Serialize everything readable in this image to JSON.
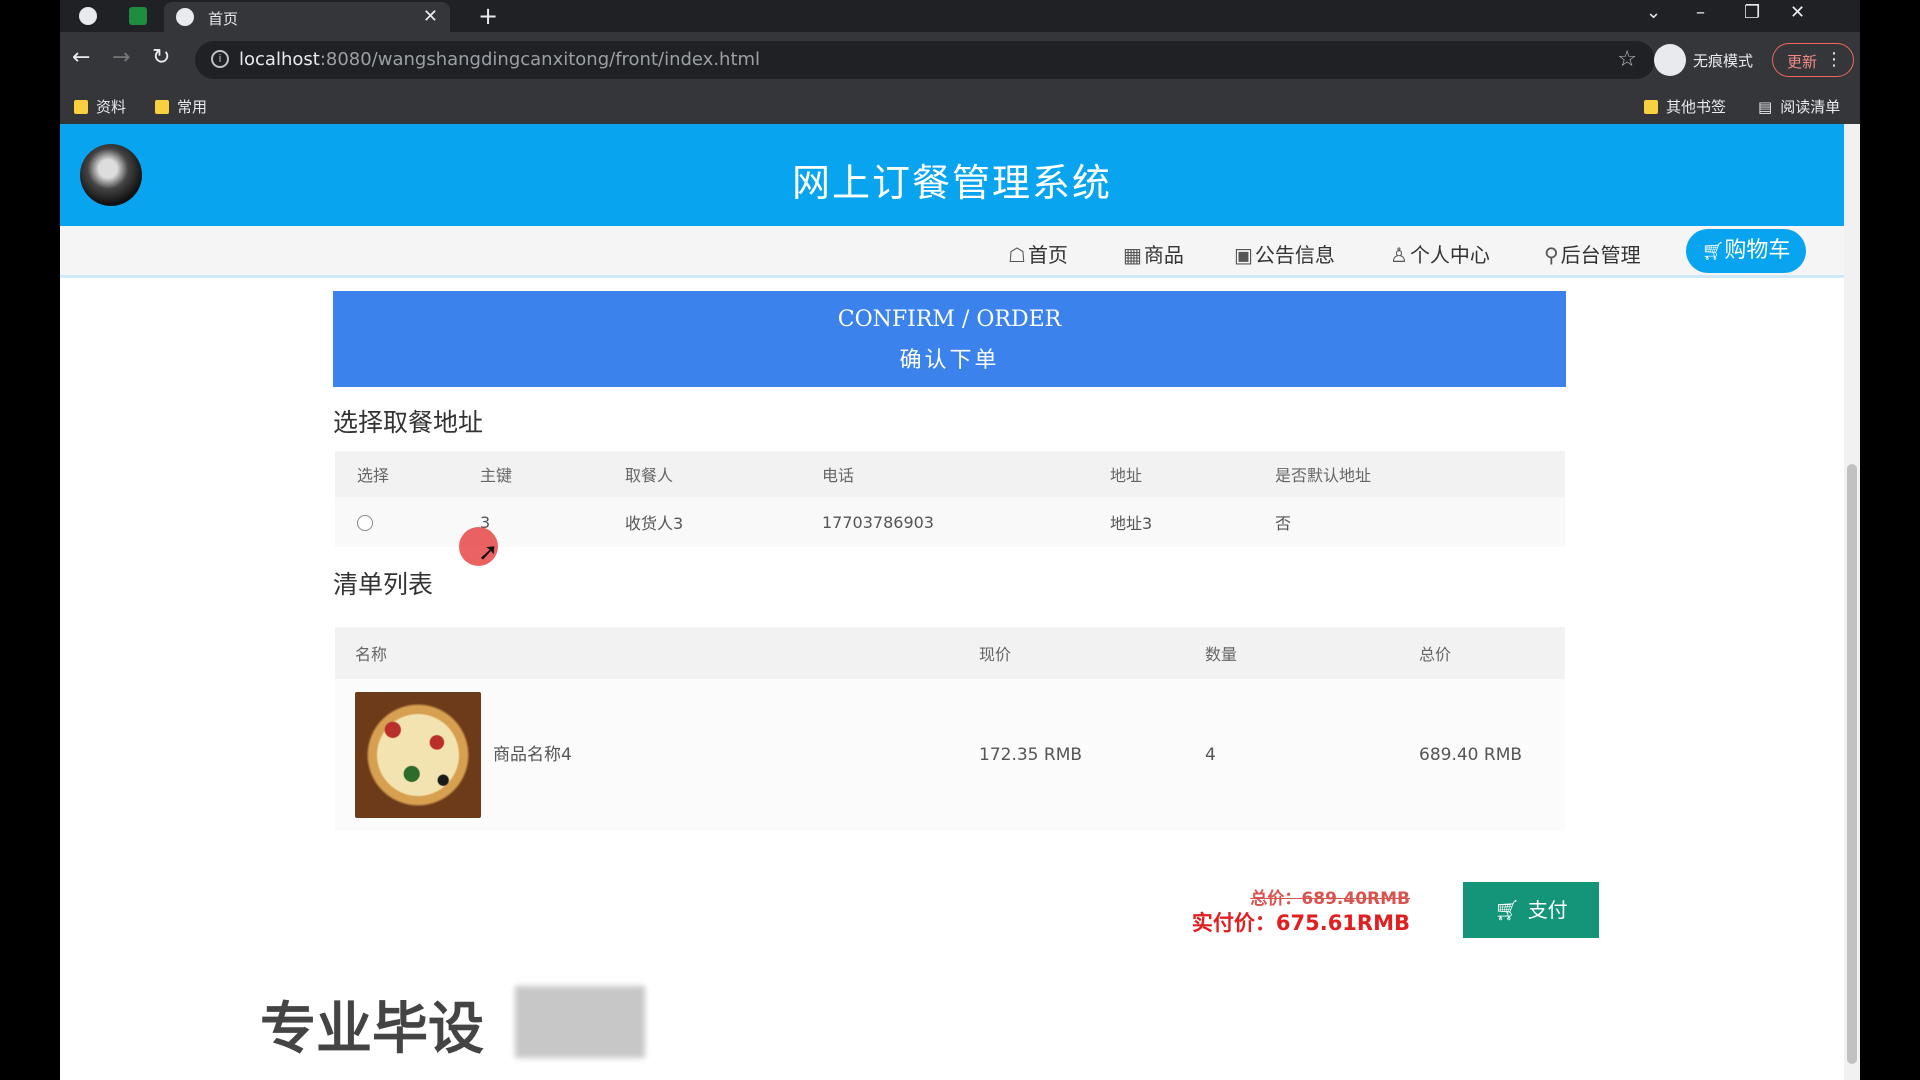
{
  "browser": {
    "tab_title": "首页",
    "url_host": "localhost",
    "url_rest": ":8080/wangshangdingcanxitong/front/index.html",
    "incognito_label": "无痕模式",
    "update_label": "更新",
    "bookmarks_left": [
      "资料",
      "常用"
    ],
    "bookmarks_right": [
      "其他书签",
      "阅读清单"
    ]
  },
  "site": {
    "title": "网上订餐管理系统",
    "nav": [
      {
        "icon": "☖",
        "label": "首页"
      },
      {
        "icon": "▦",
        "label": "商品"
      },
      {
        "icon": "▣",
        "label": "公告信息"
      },
      {
        "icon": "♙",
        "label": "个人中心"
      },
      {
        "icon": "⚲",
        "label": "后台管理"
      }
    ],
    "cart_label": "购物车"
  },
  "banner": {
    "en": "CONFIRM / ORDER",
    "cn": "确认下单"
  },
  "address": {
    "section_title": "选择取餐地址",
    "headers": [
      "选择",
      "主键",
      "取餐人",
      "电话",
      "地址",
      "是否默认地址"
    ],
    "rows": [
      {
        "id": "3",
        "recipient": "收货人3",
        "phone": "17703786903",
        "address": "地址3",
        "default": "否"
      }
    ]
  },
  "items": {
    "section_title": "清单列表",
    "headers": [
      "名称",
      "现价",
      "数量",
      "总价"
    ],
    "rows": [
      {
        "name": "商品名称4",
        "price": "172.35 RMB",
        "qty": "4",
        "total": "689.40 RMB"
      }
    ]
  },
  "summary": {
    "original_total": "总价：689.40RMB",
    "actual_total": "实付价：675.61RMB",
    "pay_label": "支付"
  },
  "overlay": {
    "watermark": "专业毕设"
  },
  "colors": {
    "header_blue": "#09a4ef",
    "banner_blue": "#3b82ec",
    "pay_green": "#14957a",
    "price_red": "#e02020"
  }
}
